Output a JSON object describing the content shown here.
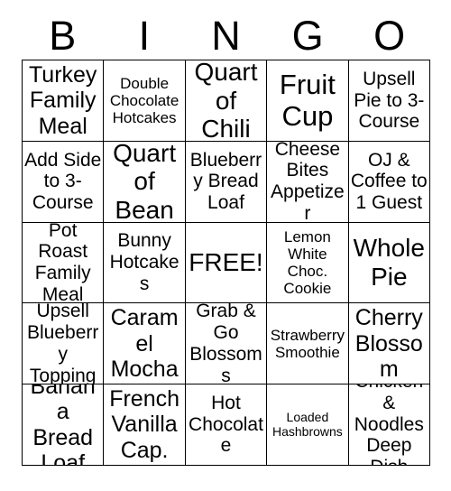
{
  "card": {
    "title": "BINGO",
    "header_letters": [
      "B",
      "I",
      "N",
      "G",
      "O"
    ],
    "free_space_label": "FREE!",
    "colors": {
      "background": "#ffffff",
      "text": "#000000",
      "border": "#000000"
    },
    "rows": [
      [
        {
          "label": "Turkey Family Meal",
          "size": "lg"
        },
        {
          "label": "Double Chocolate Hotcakes",
          "size": "sm"
        },
        {
          "label": "Quart of Chili",
          "size": "xl"
        },
        {
          "label": "Fruit Cup",
          "size": "xxl"
        },
        {
          "label": "Upsell Pie to 3-Course",
          "size": "md"
        }
      ],
      [
        {
          "label": "Add Side to 3-Course",
          "size": "md"
        },
        {
          "label": "Quart of Bean",
          "size": "xl"
        },
        {
          "label": "Blueberry Bread Loaf",
          "size": "md"
        },
        {
          "label": "Cheese Bites Appetizer",
          "size": "md"
        },
        {
          "label": "OJ & Coffee to 1 Guest",
          "size": "md"
        }
      ],
      [
        {
          "label": "Pot Roast Family Meal",
          "size": "md"
        },
        {
          "label": "Bunny Hotcakes",
          "size": "md"
        },
        {
          "label": "FREE!",
          "size": "xl"
        },
        {
          "label": "Lemon White Choc. Cookie",
          "size": "sm"
        },
        {
          "label": "Whole Pie",
          "size": "xl"
        }
      ],
      [
        {
          "label": "Upsell Blueberry Topping",
          "size": "md"
        },
        {
          "label": "Caramel Mocha",
          "size": "lg"
        },
        {
          "label": "Grab & Go Blossoms",
          "size": "md"
        },
        {
          "label": "Strawberry Smoothie",
          "size": "sm"
        },
        {
          "label": "Cherry Blossom",
          "size": "lg"
        }
      ],
      [
        {
          "label": "Banana Bread Loaf",
          "size": "lg"
        },
        {
          "label": "French Vanilla Cap.",
          "size": "lg"
        },
        {
          "label": "Hot Chocolate",
          "size": "md"
        },
        {
          "label": "Loaded Hashbrowns",
          "size": "xs"
        },
        {
          "label": "Chicken & Noodles Deep Dish",
          "size": "md"
        }
      ]
    ]
  }
}
